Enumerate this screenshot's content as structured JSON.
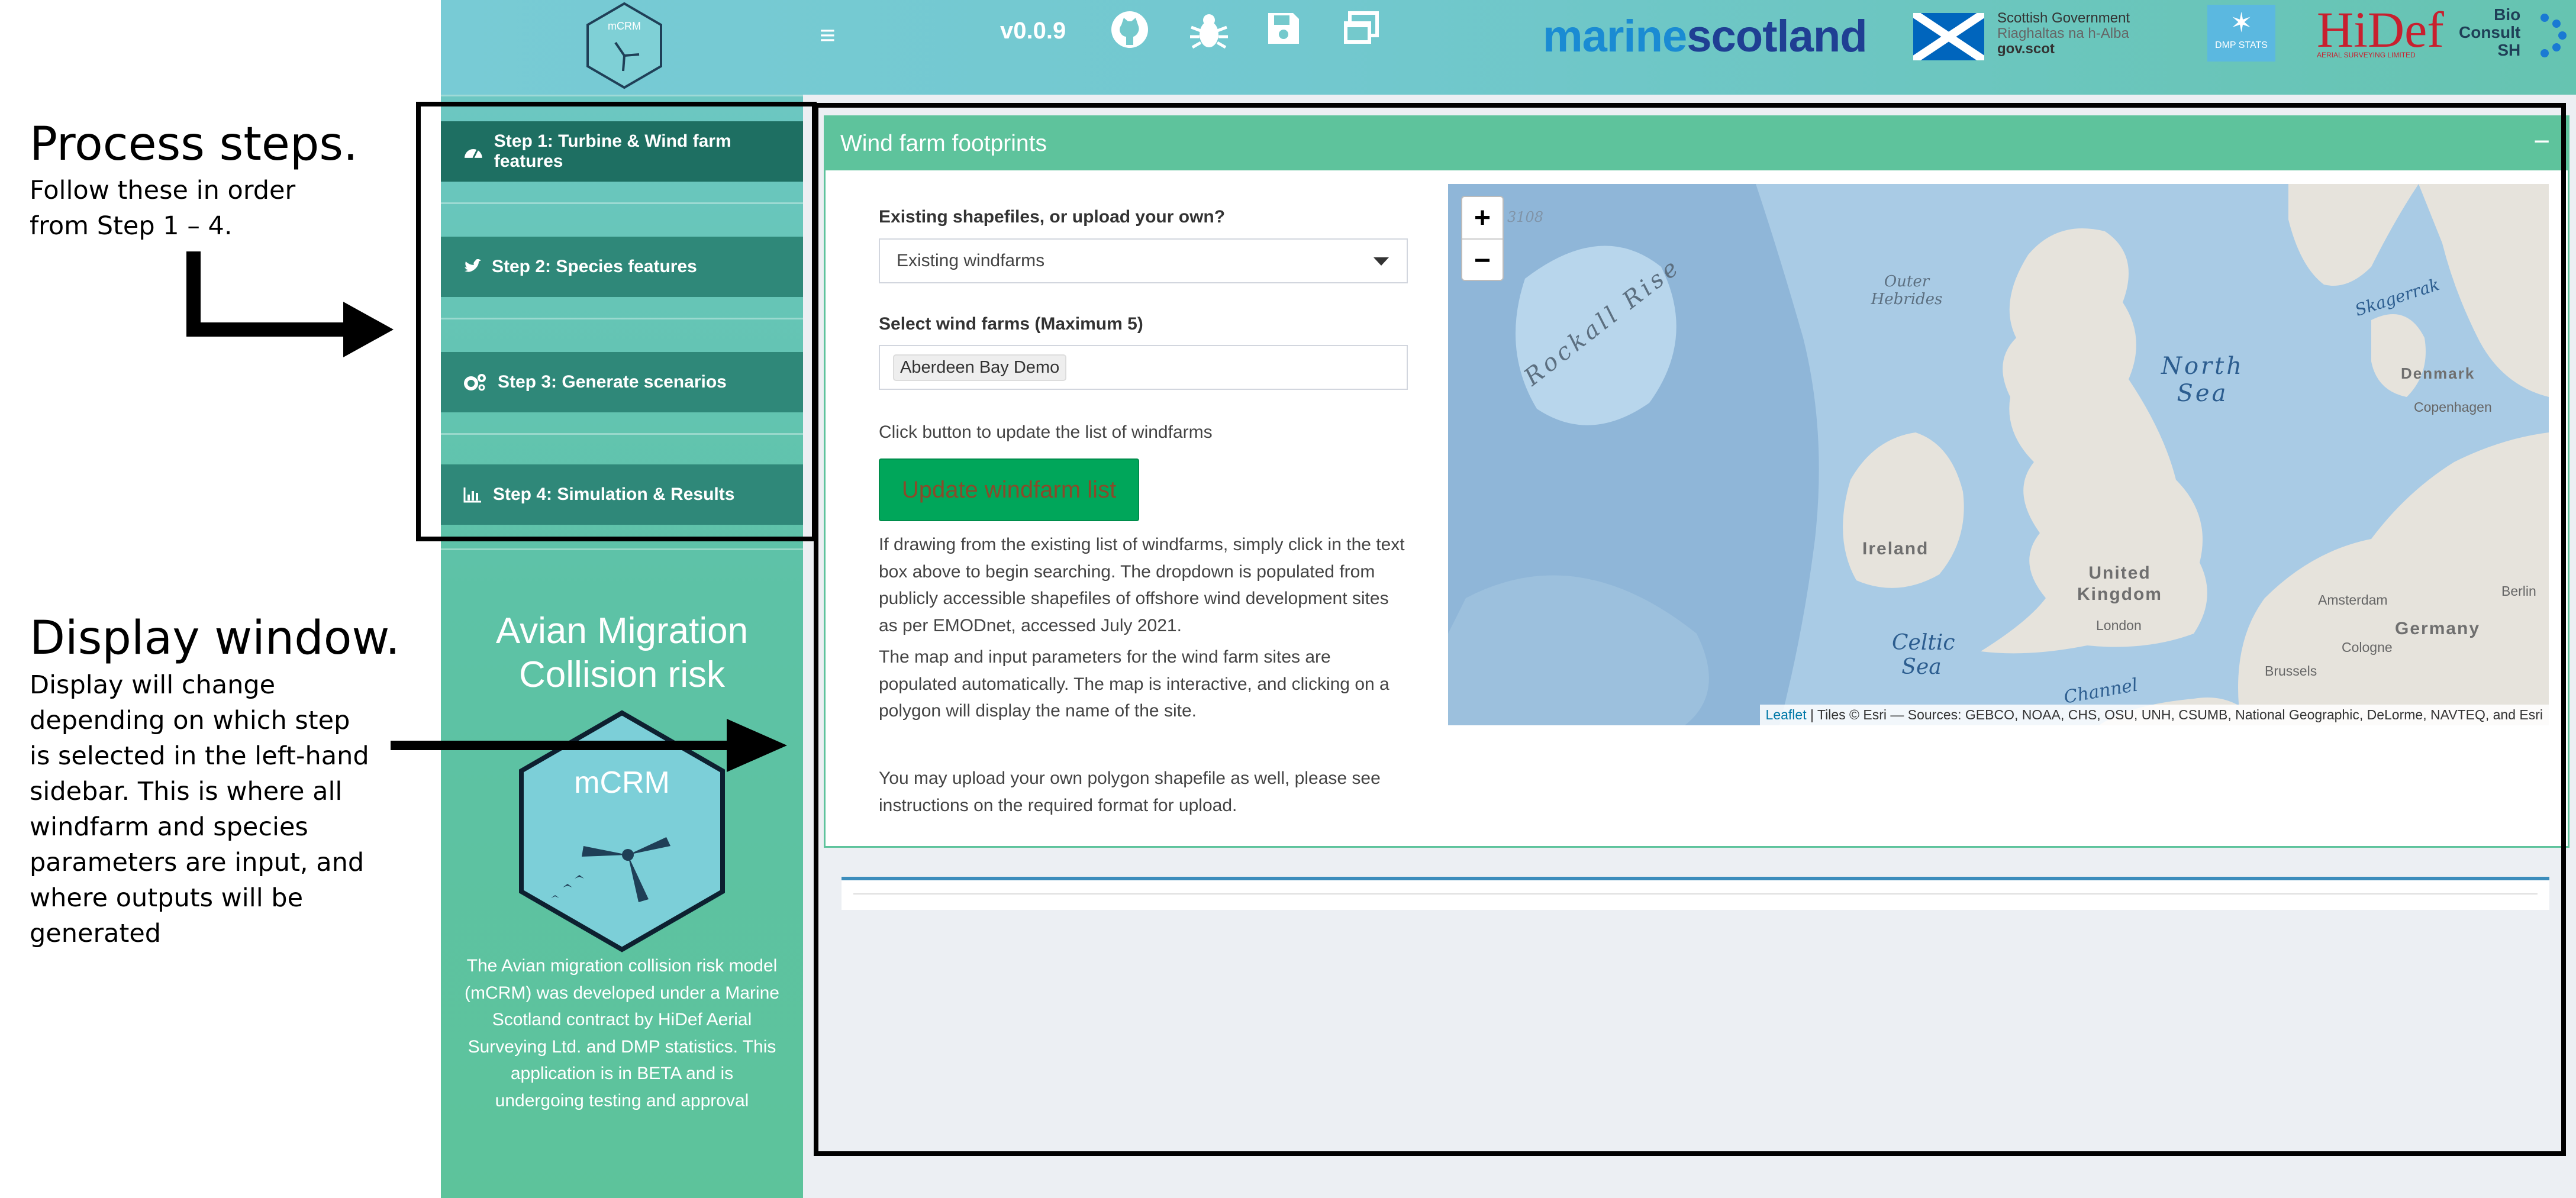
{
  "annotations": {
    "process": {
      "title": "Process steps.",
      "body": "Follow these in order from Step 1 – 4."
    },
    "display": {
      "title": "Display window.",
      "body": "Display will change depending on which step is selected in the left-hand sidebar. This is where all windfarm and species parameters are input, and where outputs will be generated"
    }
  },
  "header": {
    "logo_text": "mCRM",
    "menu_icon": "hamburger-icon",
    "version": "v0.0.9",
    "icons": [
      "github-icon",
      "bug-icon",
      "save-icon",
      "windows-icon"
    ],
    "partner_logos": {
      "marine_scotland": {
        "part1": "marine",
        "part2": "scotland"
      },
      "scot_gov": {
        "line1": "Scottish Government",
        "line2": "Riaghaltas na h-Alba",
        "line3": "gov.scot"
      },
      "dmp": "DMP STATS",
      "hidef": {
        "name": "HiDef",
        "sub": "AERIAL SURVEYING LIMITED"
      },
      "bioconsult": {
        "line1": "Bio",
        "line2": "Consult",
        "line3": "SH"
      }
    },
    "colors": {
      "header_start": "#78cbd5",
      "header_end": "#66c4b1"
    }
  },
  "sidebar": {
    "steps": [
      {
        "label": "Step 1: Turbine & Wind farm features",
        "icon": "dashboard-icon",
        "active": true
      },
      {
        "label": "Step 2: Species features",
        "icon": "twitter-bird-icon",
        "active": false
      },
      {
        "label": "Step 3: Generate scenarios",
        "icon": "cogs-icon",
        "active": false
      },
      {
        "label": "Step 4: Simulation & Results",
        "icon": "bar-chart-icon",
        "active": false
      }
    ],
    "app_title": "Avian Migration Collision risk",
    "hex_logo_text": "mCRM",
    "description": "The Avian migration collision risk model (mCRM) was developed under a Marine Scotland contract by HiDef Aerial Surveying Ltd. and DMP statistics. This application is in BETA and is undergoing testing and approval"
  },
  "main": {
    "box_title": "Wind farm footprints",
    "collapse_label": "−",
    "shapefile_label": "Existing shapefiles, or upload your own?",
    "shapefile_selected": "Existing windfarms",
    "windfarm_label": "Select wind farms (Maximum 5)",
    "windfarm_tag": "Aberdeen Bay Demo",
    "update_hint": "Click button to update the list of windfarms",
    "update_button": "Update windfarm list",
    "help1": "If drawing from the existing list of windfarms, simply click in the text box above to begin searching. The dropdown is populated from publicly accessible shapefiles of offshore wind development sites as per EMODnet, accessed July 2021.",
    "help2": "The map and input parameters for the wind farm sites are populated automatically. The map is interactive, and clicking on a polygon will display the name of the site.",
    "help3": "You may upload your own polygon shapefile as well, please see instructions on the required format for upload.",
    "map": {
      "zoom_in": "+",
      "zoom_out": "−",
      "depth_label": "3108",
      "sea_labels": {
        "rockall": "Rockall Rise",
        "outer_hebrides": "Outer Hebrides",
        "north_sea": "North Sea",
        "skagerrak": "Skagerrak",
        "celtic_sea": "Celtic Sea",
        "channel": "Channel"
      },
      "land_labels": {
        "ireland": "Ireland",
        "uk": "United Kingdom",
        "germany": "Germany",
        "denmark": "Denmark"
      },
      "cities": {
        "copenhagen": "Copenhagen",
        "berlin": "Berlin",
        "amsterdam": "Amsterdam",
        "london": "London",
        "cologne": "Cologne",
        "brussels": "Brussels"
      },
      "attribution_link": "Leaflet",
      "attribution_rest": " | Tiles © Esri — Sources: GEBCO, NOAA, CHS, OSU, UNH, CSUMB, National Geographic, DeLorme, NAVTEQ, and Esri"
    }
  }
}
